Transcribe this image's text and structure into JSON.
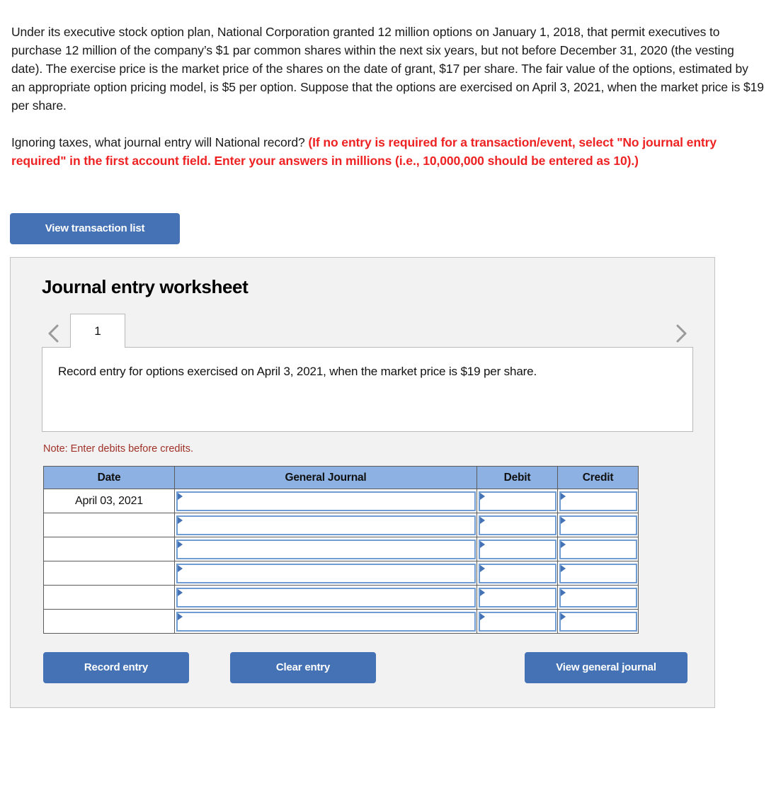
{
  "problem": {
    "statement": "Under its executive stock option plan, National Corporation granted 12 million options on January 1, 2018, that permit executives to purchase 12 million of the company’s $1 par common shares within the next six years, but not before December 31, 2020 (the vesting date). The exercise price is the market price of the shares on the date of grant, $17 per share. The fair value of the options, estimated by an appropriate option pricing model, is $5 per option. Suppose that the options are exercised on April 3, 2021, when the market price is $19 per share.",
    "question": "Ignoring taxes, what journal entry will National record? ",
    "requirement": "(If no entry is required for a transaction/event, select \"No journal entry required\" in the first account field. Enter your answers in millions (i.e., 10,000,000 should be entered as 10).)",
    "requirement_color": "#ee2222"
  },
  "toolbar": {
    "view_transaction_list_label": "View transaction list"
  },
  "worksheet": {
    "title": "Journal entry worksheet",
    "prev_icon": "chevron-left-icon",
    "next_icon": "chevron-right-icon",
    "tabs": [
      {
        "label": "1",
        "active": true
      }
    ],
    "prompt": "Record entry for options exercised on April 3, 2021, when the market price is $19 per share.",
    "note": "Note: Enter debits before credits.",
    "note_color": "#a03128",
    "table": {
      "headers": [
        "Date",
        "General Journal",
        "Debit",
        "Credit"
      ],
      "header_bg": "#8cb1e2",
      "rows": [
        {
          "date": "April 03, 2021",
          "general_journal": "",
          "debit": "",
          "credit": ""
        },
        {
          "date": "",
          "general_journal": "",
          "debit": "",
          "credit": ""
        },
        {
          "date": "",
          "general_journal": "",
          "debit": "",
          "credit": ""
        },
        {
          "date": "",
          "general_journal": "",
          "debit": "",
          "credit": ""
        },
        {
          "date": "",
          "general_journal": "",
          "debit": "",
          "credit": ""
        },
        {
          "date": "",
          "general_journal": "",
          "debit": "",
          "credit": ""
        }
      ]
    },
    "buttons": {
      "record_entry": "Record entry",
      "clear_entry": "Clear entry",
      "view_general_journal": "View general journal",
      "accent_color": "#4472b4"
    }
  }
}
